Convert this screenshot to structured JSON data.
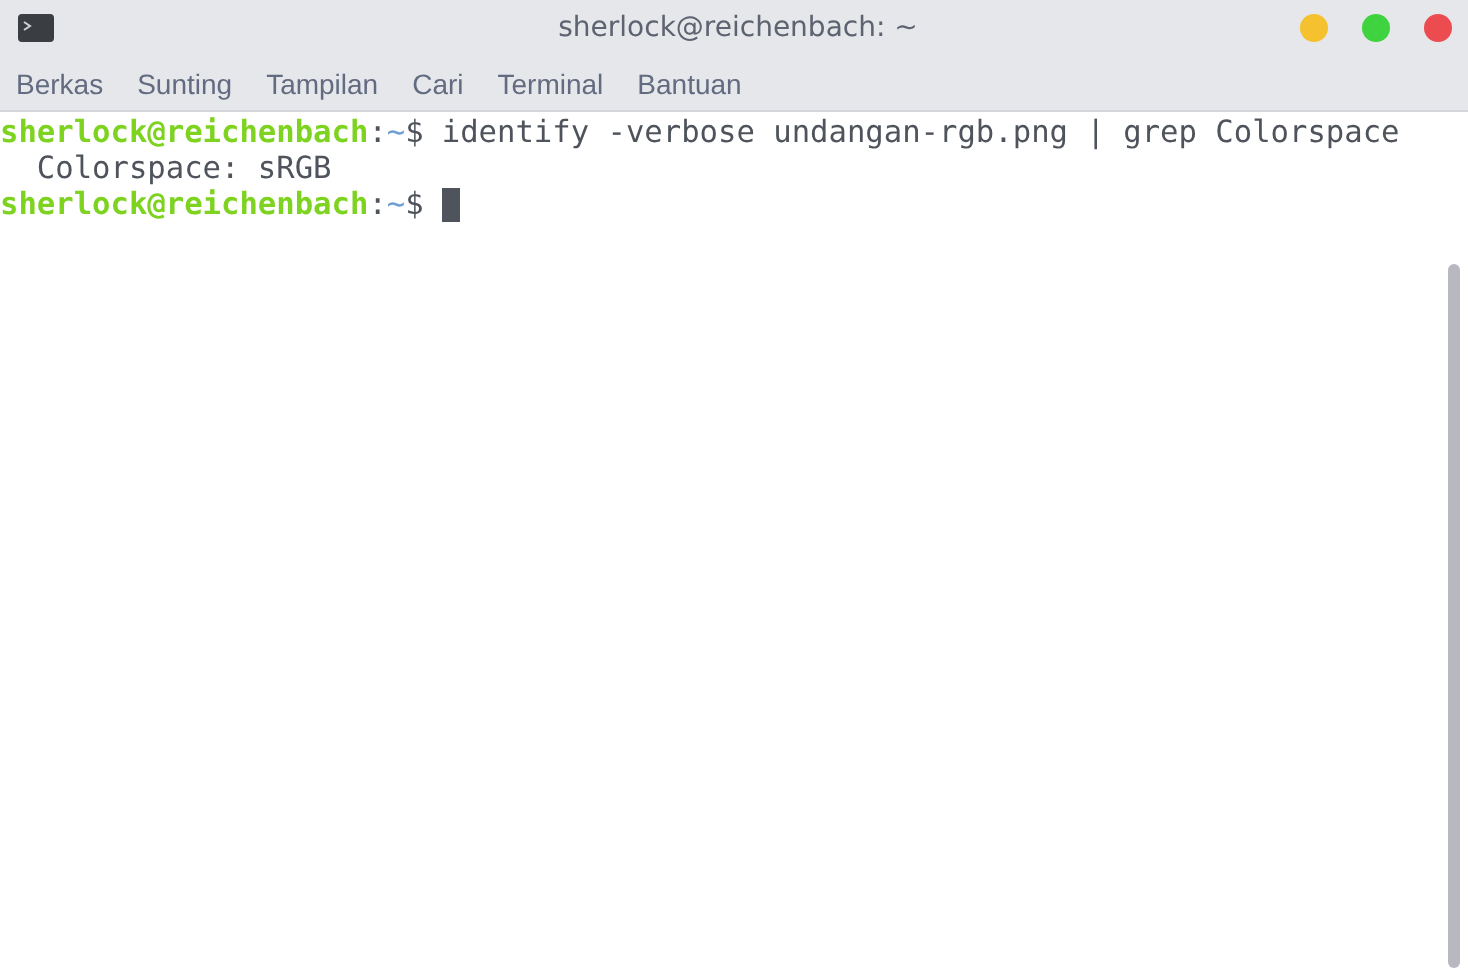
{
  "window": {
    "title": "sherlock@reichenbach: ~"
  },
  "menu": [
    {
      "label": "Berkas"
    },
    {
      "label": "Sunting"
    },
    {
      "label": "Tampilan"
    },
    {
      "label": "Cari"
    },
    {
      "label": "Terminal"
    },
    {
      "label": "Bantuan"
    }
  ],
  "terminal": {
    "lines": [
      {
        "kind": "prompt",
        "user_host": "sherlock@reichenbach",
        "separator": ":",
        "path": "~",
        "symbol": "$",
        "command": "identify -verbose undangan-rgb.png | grep Colorspace"
      },
      {
        "kind": "output",
        "text": "  Colorspace: sRGB"
      },
      {
        "kind": "prompt",
        "user_host": "sherlock@reichenbach",
        "separator": ":",
        "path": "~",
        "symbol": "$",
        "cursor": true
      }
    ]
  }
}
